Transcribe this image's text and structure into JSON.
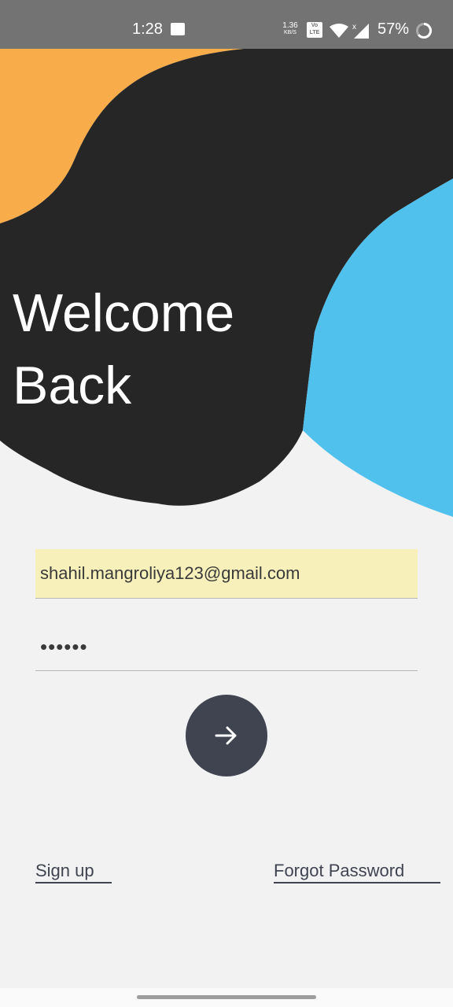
{
  "status_bar": {
    "time": "1:28",
    "net_speed_value": "1.36",
    "net_speed_unit": "KB/S",
    "volte_top": "Vo",
    "volte_bottom": "LTE",
    "battery": "57%"
  },
  "colors": {
    "orange_blob": "#f9ac4a",
    "dark_blob": "#262626",
    "blue_blob": "#4fc1ec",
    "background": "#f2f2f2",
    "button": "#3f4450",
    "email_autofill": "#f7f0ba"
  },
  "welcome": {
    "line1": "Welcome",
    "line2": "Back"
  },
  "form": {
    "email_value": "shahil.mangroliya123@gmail.com",
    "password_value": "••••••"
  },
  "icons": {
    "submit": "arrow-right-icon",
    "status_image": "image-icon",
    "wifi": "wifi-icon",
    "signal": "signal-icon",
    "battery": "battery-icon"
  },
  "links": {
    "sign_up": "Sign up",
    "forgot_password": "Forgot Password"
  }
}
